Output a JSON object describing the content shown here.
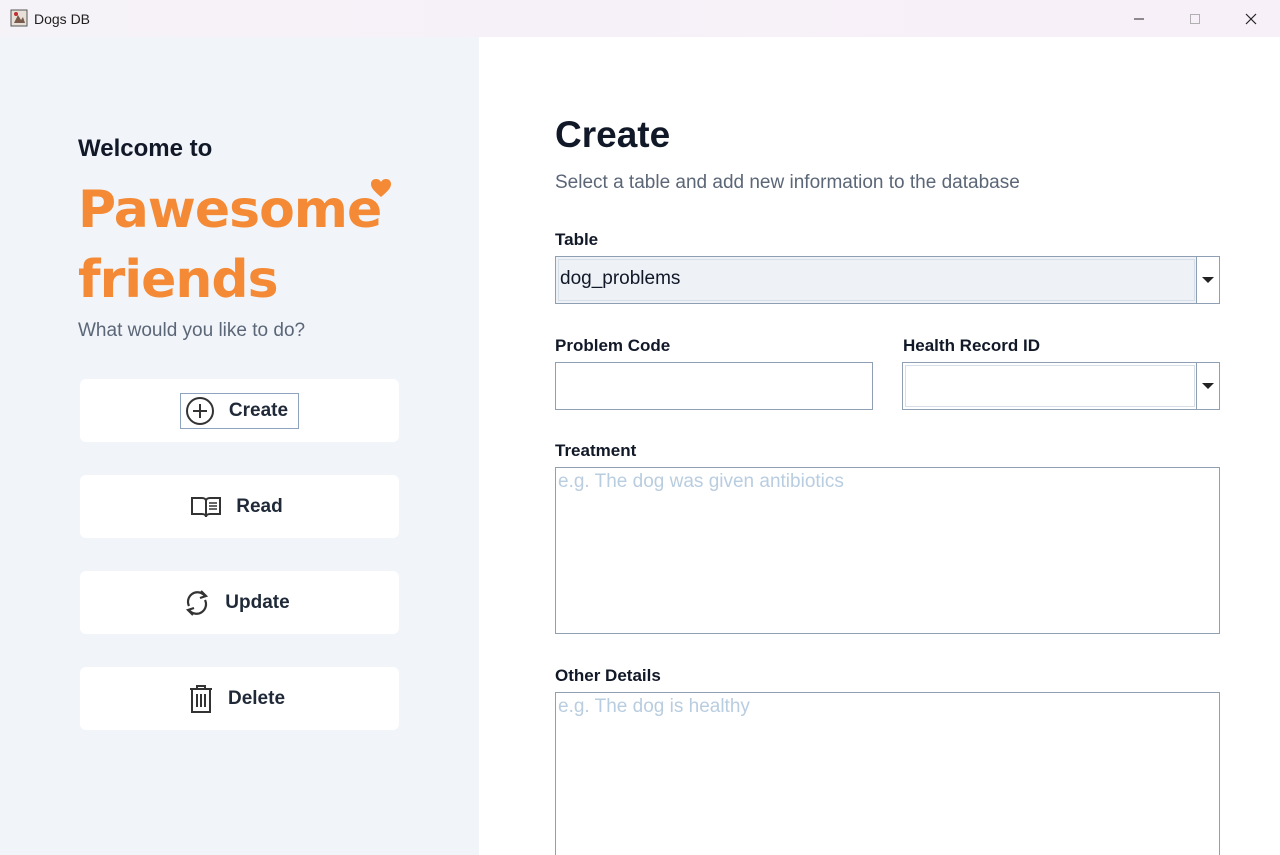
{
  "window": {
    "title": "Dogs DB"
  },
  "sidebar": {
    "welcome": "Welcome to",
    "brand_line1": "Pawesome",
    "brand_line2": "friends",
    "question": "What would you like to do?",
    "items": [
      {
        "label": "Create",
        "icon": "plus-circle-icon"
      },
      {
        "label": "Read",
        "icon": "book-icon"
      },
      {
        "label": "Update",
        "icon": "refresh-icon"
      },
      {
        "label": "Delete",
        "icon": "trash-icon"
      }
    ]
  },
  "main": {
    "title": "Create",
    "subtitle": "Select a table and add new information to the database",
    "table_label": "Table",
    "table_value": "dog_problems",
    "problem_code_label": "Problem Code",
    "problem_code_value": "",
    "health_record_label": "Health Record ID",
    "health_record_value": "",
    "treatment_label": "Treatment",
    "treatment_placeholder": "e.g. The dog was given antibiotics",
    "other_details_label": "Other Details",
    "other_details_placeholder": "e.g. The dog is healthy"
  },
  "colors": {
    "brand": "#f48a35",
    "sidebar_bg": "#f1f4f8",
    "placeholder": "#b9cde0"
  }
}
